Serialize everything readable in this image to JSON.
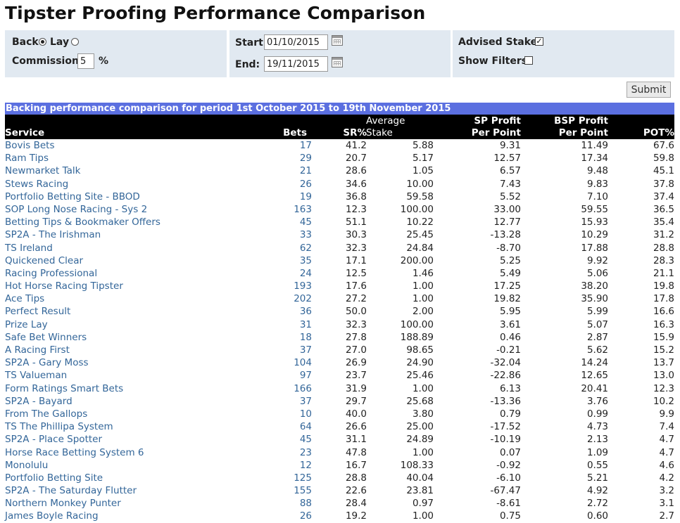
{
  "page": {
    "title": "Tipster Proofing Performance Comparison"
  },
  "filters": {
    "back_label": "Back",
    "lay_label": "Lay",
    "bet_type_selected": "Back",
    "commission_label": "Commission:",
    "commission_value": "5",
    "commission_unit": "%",
    "start_label": "Start:",
    "start_value": "01/10/2015",
    "end_label": "End:",
    "end_value": "19/11/2015",
    "advised_stakes_label": "Advised Stakes",
    "advised_stakes_checked": true,
    "show_filters_label": "Show Filters:",
    "show_filters_checked": false,
    "submit_label": "Submit",
    "calendar_icon": "calendar-icon"
  },
  "table": {
    "caption": "Backing performance comparison for period 1st October 2015 to 19th November 2015",
    "headers": {
      "service": "Service",
      "bets": "Bets",
      "sr": "SR%",
      "stake_top": "Average",
      "stake": "Stake",
      "sp_top": "SP Profit",
      "sp": "Per Point",
      "bsp_top": "BSP Profit",
      "bsp": "Per Point",
      "pot": "POT%"
    },
    "rows": [
      {
        "service": "Bovis Bets",
        "bets": "17",
        "sr": "41.2",
        "stake": "5.88",
        "sp": "9.31",
        "bsp": "11.49",
        "pot": "67.6"
      },
      {
        "service": "Ram Tips",
        "bets": "29",
        "sr": "20.7",
        "stake": "5.17",
        "sp": "12.57",
        "bsp": "17.34",
        "pot": "59.8"
      },
      {
        "service": "Newmarket Talk",
        "bets": "21",
        "sr": "28.6",
        "stake": "1.05",
        "sp": "6.57",
        "bsp": "9.48",
        "pot": "45.1"
      },
      {
        "service": "Stews Racing",
        "bets": "26",
        "sr": "34.6",
        "stake": "10.00",
        "sp": "7.43",
        "bsp": "9.83",
        "pot": "37.8"
      },
      {
        "service": "Portfolio Betting Site - BBOD",
        "bets": "19",
        "sr": "36.8",
        "stake": "59.58",
        "sp": "5.52",
        "bsp": "7.10",
        "pot": "37.4"
      },
      {
        "service": "SOP Long Nose Racing - Sys 2",
        "bets": "163",
        "sr": "12.3",
        "stake": "100.00",
        "sp": "33.00",
        "bsp": "59.55",
        "pot": "36.5"
      },
      {
        "service": "Betting Tips & Bookmaker Offers",
        "bets": "45",
        "sr": "51.1",
        "stake": "10.22",
        "sp": "12.77",
        "bsp": "15.93",
        "pot": "35.4"
      },
      {
        "service": "SP2A - The Irishman",
        "bets": "33",
        "sr": "30.3",
        "stake": "25.45",
        "sp": "-13.28",
        "bsp": "10.29",
        "pot": "31.2"
      },
      {
        "service": "TS Ireland",
        "bets": "62",
        "sr": "32.3",
        "stake": "24.84",
        "sp": "-8.70",
        "bsp": "17.88",
        "pot": "28.8"
      },
      {
        "service": "Quickened Clear",
        "bets": "35",
        "sr": "17.1",
        "stake": "200.00",
        "sp": "5.25",
        "bsp": "9.92",
        "pot": "28.3"
      },
      {
        "service": "Racing Professional",
        "bets": "24",
        "sr": "12.5",
        "stake": "1.46",
        "sp": "5.49",
        "bsp": "5.06",
        "pot": "21.1"
      },
      {
        "service": "Hot Horse Racing Tipster",
        "bets": "193",
        "sr": "17.6",
        "stake": "1.00",
        "sp": "17.25",
        "bsp": "38.20",
        "pot": "19.8"
      },
      {
        "service": "Ace Tips",
        "bets": "202",
        "sr": "27.2",
        "stake": "1.00",
        "sp": "19.82",
        "bsp": "35.90",
        "pot": "17.8"
      },
      {
        "service": "Perfect Result",
        "bets": "36",
        "sr": "50.0",
        "stake": "2.00",
        "sp": "5.95",
        "bsp": "5.99",
        "pot": "16.6"
      },
      {
        "service": "Prize Lay",
        "bets": "31",
        "sr": "32.3",
        "stake": "100.00",
        "sp": "3.61",
        "bsp": "5.07",
        "pot": "16.3"
      },
      {
        "service": "Safe Bet Winners",
        "bets": "18",
        "sr": "27.8",
        "stake": "188.89",
        "sp": "0.46",
        "bsp": "2.87",
        "pot": "15.9"
      },
      {
        "service": "A Racing First",
        "bets": "37",
        "sr": "27.0",
        "stake": "98.65",
        "sp": "-0.21",
        "bsp": "5.62",
        "pot": "15.2"
      },
      {
        "service": "SP2A - Gary Moss",
        "bets": "104",
        "sr": "26.9",
        "stake": "24.90",
        "sp": "-32.04",
        "bsp": "14.24",
        "pot": "13.7"
      },
      {
        "service": "TS Valueman",
        "bets": "97",
        "sr": "23.7",
        "stake": "25.46",
        "sp": "-22.86",
        "bsp": "12.65",
        "pot": "13.0"
      },
      {
        "service": "Form Ratings Smart Bets",
        "bets": "166",
        "sr": "31.9",
        "stake": "1.00",
        "sp": "6.13",
        "bsp": "20.41",
        "pot": "12.3"
      },
      {
        "service": "SP2A - Bayard",
        "bets": "37",
        "sr": "29.7",
        "stake": "25.68",
        "sp": "-13.36",
        "bsp": "3.76",
        "pot": "10.2"
      },
      {
        "service": "From The Gallops",
        "bets": "10",
        "sr": "40.0",
        "stake": "3.80",
        "sp": "0.79",
        "bsp": "0.99",
        "pot": "9.9"
      },
      {
        "service": "TS The Phillipa System",
        "bets": "64",
        "sr": "26.6",
        "stake": "25.00",
        "sp": "-17.52",
        "bsp": "4.73",
        "pot": "7.4"
      },
      {
        "service": "SP2A - Place Spotter",
        "bets": "45",
        "sr": "31.1",
        "stake": "24.89",
        "sp": "-10.19",
        "bsp": "2.13",
        "pot": "4.7"
      },
      {
        "service": "Horse Race Betting System 6",
        "bets": "23",
        "sr": "47.8",
        "stake": "1.00",
        "sp": "0.07",
        "bsp": "1.09",
        "pot": "4.7"
      },
      {
        "service": "Monolulu",
        "bets": "12",
        "sr": "16.7",
        "stake": "108.33",
        "sp": "-0.92",
        "bsp": "0.55",
        "pot": "4.6"
      },
      {
        "service": "Portfolio Betting Site",
        "bets": "125",
        "sr": "28.8",
        "stake": "40.04",
        "sp": "-6.10",
        "bsp": "5.21",
        "pot": "4.2"
      },
      {
        "service": "SP2A - The Saturday Flutter",
        "bets": "155",
        "sr": "22.6",
        "stake": "23.81",
        "sp": "-67.47",
        "bsp": "4.92",
        "pot": "3.2"
      },
      {
        "service": "Northern Monkey Punter",
        "bets": "88",
        "sr": "28.4",
        "stake": "0.97",
        "sp": "-8.61",
        "bsp": "2.72",
        "pot": "3.1"
      },
      {
        "service": "James Boyle Racing",
        "bets": "26",
        "sr": "19.2",
        "stake": "1.00",
        "sp": "0.75",
        "bsp": "0.60",
        "pot": "2.7"
      }
    ]
  }
}
